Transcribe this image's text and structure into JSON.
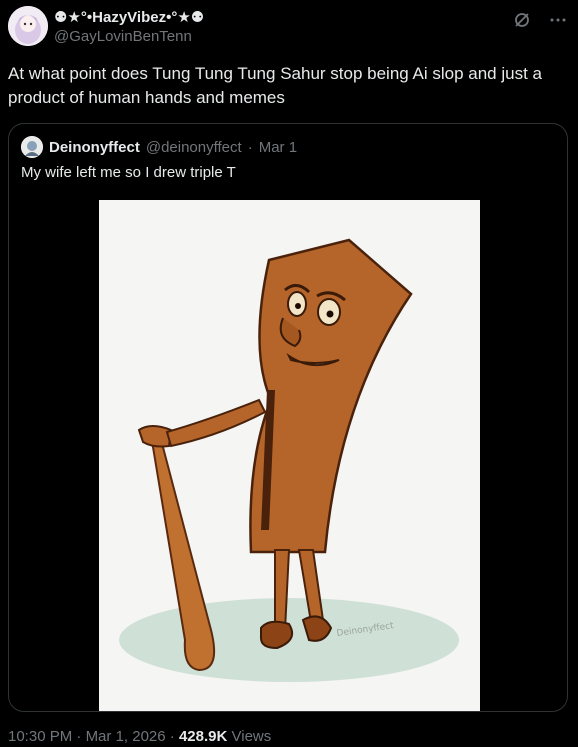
{
  "post": {
    "display_name": "★°•HazyVibez•°★",
    "handle": "@GayLovinBenTenn",
    "text": "At what point does Tung Tung Tung Sahur stop being Ai slop and just a product of human hands and memes",
    "icons": [
      "grok-icon",
      "more-icon"
    ]
  },
  "quote": {
    "display_name": "Deinonyffect",
    "handle": "@deinonyffect",
    "separator": "·",
    "date": "Mar 1",
    "text": "My wife left me so I drew triple T",
    "image_signature": "Deinonyffect"
  },
  "footer": {
    "time": "10:30 PM",
    "sep1": "·",
    "date": "Mar 1, 2026",
    "sep2": "·",
    "views": "428.9K",
    "views_label": "Views"
  },
  "colors": {
    "background": "#000000",
    "text": "#e7e9ea",
    "secondary": "#71767b",
    "border": "#2f3336",
    "wood": "#b5652a"
  }
}
